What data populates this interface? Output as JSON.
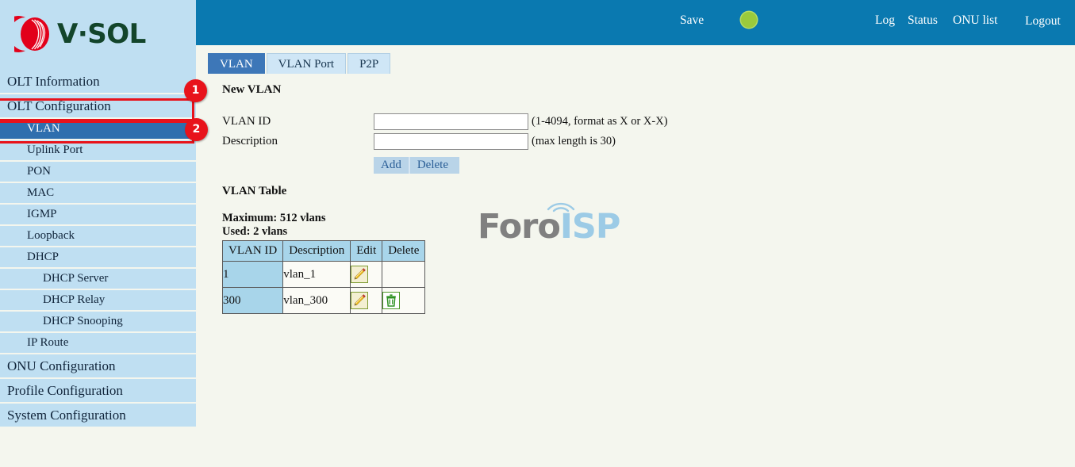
{
  "brand": {
    "logo_text": "V·SOL",
    "logo_mark": "vsol-swirl-icon",
    "logo_color": "#e2001a",
    "text_color": "#13452b"
  },
  "header": {
    "background": "#0a79b0",
    "save_label": "Save",
    "status_indicator": {
      "name": "status-dot",
      "color": "#9aca3c"
    },
    "links": [
      {
        "label": "Log"
      },
      {
        "label": "Status"
      },
      {
        "label": "ONU list"
      },
      {
        "label": "Logout"
      }
    ]
  },
  "sidebar": {
    "items": [
      {
        "label": "OLT Information",
        "level": 0,
        "active": false
      },
      {
        "label": "OLT Configuration",
        "level": 0,
        "active": false
      },
      {
        "label": "VLAN",
        "level": 1,
        "active": true
      },
      {
        "label": "Uplink Port",
        "level": 1,
        "active": false
      },
      {
        "label": "PON",
        "level": 1,
        "active": false
      },
      {
        "label": "MAC",
        "level": 1,
        "active": false
      },
      {
        "label": "IGMP",
        "level": 1,
        "active": false
      },
      {
        "label": "Loopback",
        "level": 1,
        "active": false
      },
      {
        "label": "DHCP",
        "level": 1,
        "active": false
      },
      {
        "label": "DHCP Server",
        "level": 2,
        "active": false
      },
      {
        "label": "DHCP Relay",
        "level": 2,
        "active": false
      },
      {
        "label": "DHCP Snooping",
        "level": 2,
        "active": false
      },
      {
        "label": "IP Route",
        "level": 1,
        "active": false
      },
      {
        "label": "ONU Configuration",
        "level": 0,
        "active": false
      },
      {
        "label": "Profile Configuration",
        "level": 0,
        "active": false
      },
      {
        "label": "System Configuration",
        "level": 0,
        "active": false
      }
    ],
    "item_background": "#bfdff2",
    "active_background": "#2f6fae"
  },
  "annotations": {
    "color": "#e8131b",
    "badges": [
      {
        "number": "1",
        "target": "OLT Configuration"
      },
      {
        "number": "2",
        "target": "VLAN"
      }
    ]
  },
  "tabs": [
    {
      "label": "VLAN",
      "active": true
    },
    {
      "label": "VLAN Port",
      "active": false
    },
    {
      "label": "P2P",
      "active": false
    }
  ],
  "new_vlan": {
    "heading": "New VLAN",
    "fields": [
      {
        "label": "VLAN ID",
        "value": "",
        "placeholder": "",
        "hint": "(1-4094, format as X or X-X)"
      },
      {
        "label": "Description",
        "value": "",
        "placeholder": "",
        "hint": "(max length is 30)"
      }
    ],
    "buttons": [
      {
        "label": "Add"
      },
      {
        "label": "Delete"
      }
    ]
  },
  "vlan_table": {
    "heading": "VLAN Table",
    "maximum_text": "Maximum: 512 vlans",
    "used_text": "Used: 2 vlans",
    "columns": [
      "VLAN ID",
      "Description",
      "Edit",
      "Delete"
    ],
    "rows": [
      {
        "vlan_id": "1",
        "description": "vlan_1",
        "edit": "edit-pencil-icon",
        "delete": ""
      },
      {
        "vlan_id": "300",
        "description": "vlan_300",
        "edit": "edit-pencil-icon",
        "delete": "trash-icon"
      }
    ]
  },
  "watermark": {
    "part1": "Foro",
    "part2": "ISP",
    "part1_color": "#808080",
    "part2_color": "#9ccbe6"
  }
}
